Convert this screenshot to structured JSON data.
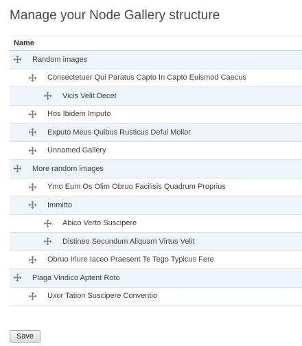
{
  "page": {
    "title": "Manage your Node Gallery structure"
  },
  "table": {
    "column_name": "Name",
    "rows": [
      {
        "label": "Random images",
        "depth": 0
      },
      {
        "label": "Consectetuer Qui Paratus Capto In Capto Euismod Caecus",
        "depth": 1
      },
      {
        "label": "Vicis Velit Decet",
        "depth": 2
      },
      {
        "label": "Hos Ibidem Imputo",
        "depth": 1
      },
      {
        "label": "Exputo Meus Quibus Rusticus Defui Molior",
        "depth": 1
      },
      {
        "label": "Unnamed Gallery",
        "depth": 1
      },
      {
        "label": "More random images",
        "depth": 0
      },
      {
        "label": "Ymo Eum Os Olim Obruo Facilisis Quadrum Proprius",
        "depth": 1
      },
      {
        "label": "Immitto",
        "depth": 1
      },
      {
        "label": "Abico Verto Suscipere",
        "depth": 2
      },
      {
        "label": "Distineo Secundum Aliquam Virtus Velit",
        "depth": 2
      },
      {
        "label": "Obruo Iriure Iaceo Praesent Te Tego Typicus Fere",
        "depth": 1
      },
      {
        "label": "Plaga Vindico Aptent Roto",
        "depth": 0
      },
      {
        "label": "Uxor Tation Suscipere Conventio",
        "depth": 1
      }
    ]
  },
  "actions": {
    "save_label": "Save"
  },
  "icons": {
    "drag_handle": "move-cross-icon"
  },
  "colors": {
    "row_alt": "#eef4fa",
    "row_border": "#d4e3ee",
    "text": "#3f3f3f"
  }
}
